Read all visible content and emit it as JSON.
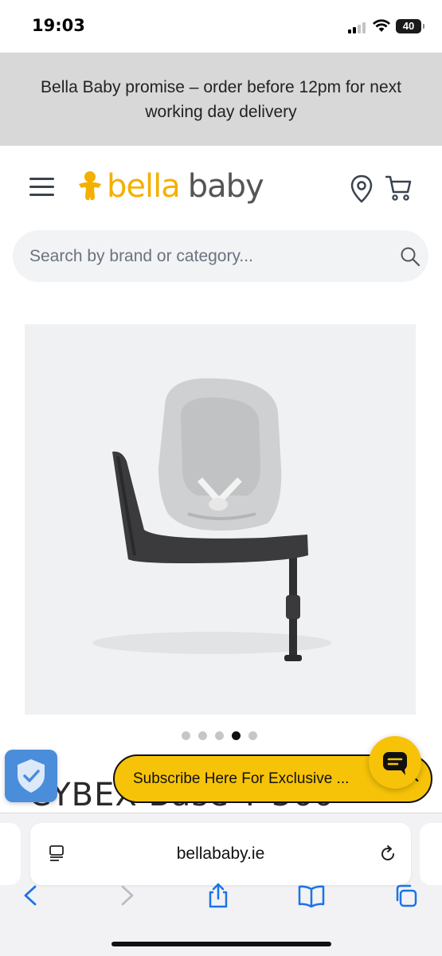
{
  "status_bar": {
    "time": "19:03",
    "battery": "40"
  },
  "promo": {
    "text": "Bella Baby promise – order before 12pm for next working day delivery"
  },
  "header": {
    "logo_word_1": "bella",
    "logo_word_2": "baby",
    "brand_color": "#f4b000"
  },
  "search": {
    "placeholder": "Search by brand or category..."
  },
  "product": {
    "title": "CYBEX Base T 360",
    "image_icon": "car-seat-image",
    "carousel": {
      "slide_count": 5,
      "active_index": 4
    }
  },
  "subscribe": {
    "label": "Subscribe Here For Exclusive ...",
    "close": "✕",
    "color": "#f6c309"
  },
  "browser": {
    "url": "bellababy.ie"
  }
}
